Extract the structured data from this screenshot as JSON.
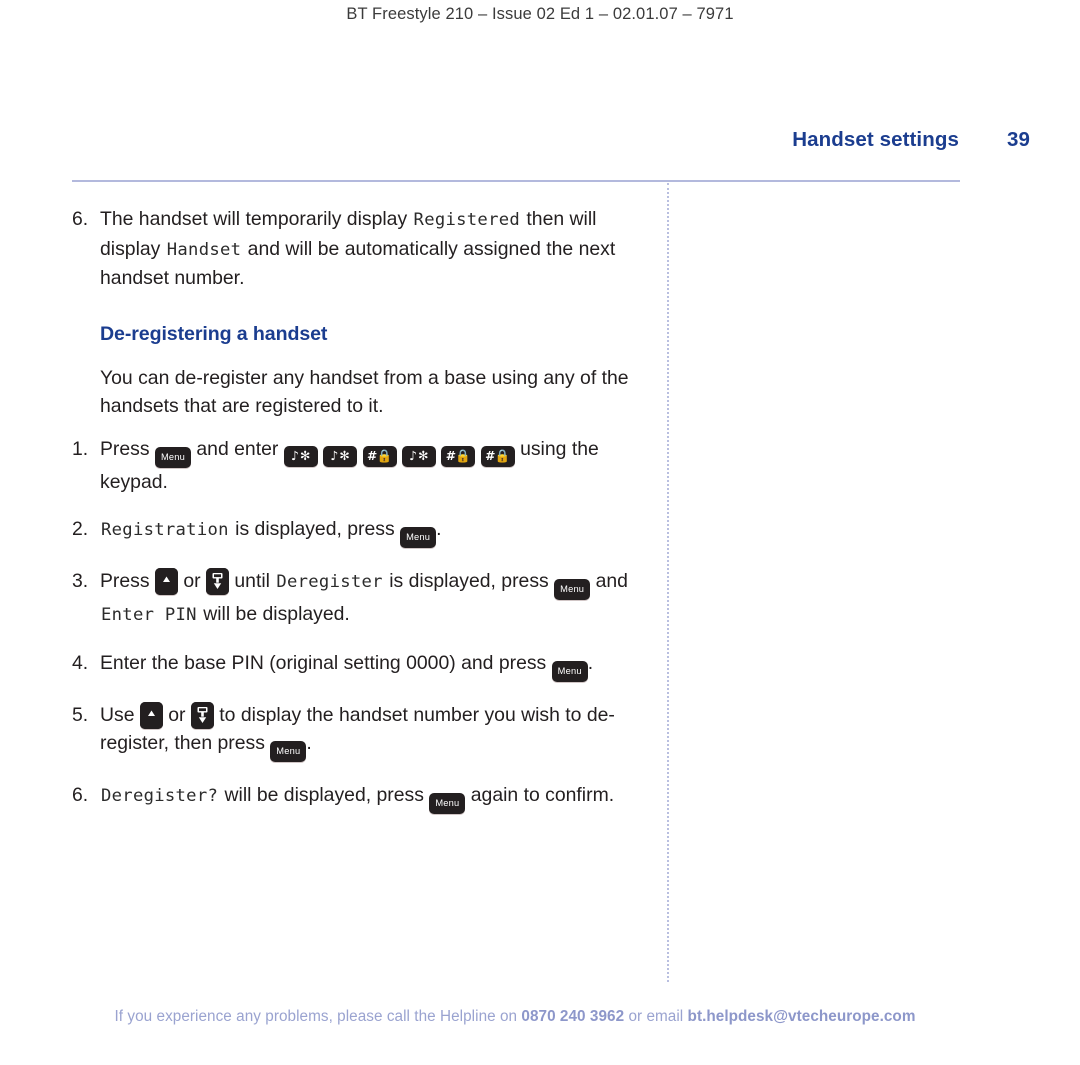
{
  "running_head": "BT Freestyle 210 – Issue 02 Ed 1 – 02.01.07 – 7971",
  "header": {
    "chapter_title": "Handset settings",
    "page_number": "39",
    "accent_color": "#1b3d8f"
  },
  "content": {
    "step6_top": {
      "number": "6.",
      "text_a": "The handset will temporarily display ",
      "lcd_a": "Registered",
      "text_b": " then will display ",
      "lcd_b": "Handset",
      "text_c": " and will be automatically assigned the next handset number."
    },
    "subheading": "De-registering a handset",
    "intro_paragraph": "You can de-register any handset from a base using any of the handsets that are registered to it.",
    "steps": [
      {
        "number": "1.",
        "text_a": "Press ",
        "key_menu": "Menu",
        "text_b": " and enter ",
        "keys": [
          "star",
          "star",
          "hash",
          "star",
          "hash",
          "hash"
        ],
        "text_c": " using the keypad."
      },
      {
        "number": "2.",
        "lcd_a": "Registration",
        "text_a": " is displayed, press ",
        "key_menu": "Menu",
        "text_b": "."
      },
      {
        "number": "3.",
        "text_a": "Press ",
        "key_up": "up",
        "text_b": " or ",
        "key_down": "down",
        "text_c": " until ",
        "lcd_a": "Deregister",
        "text_d": " is displayed, press ",
        "key_menu": "Menu",
        "text_e": " and ",
        "lcd_b": "Enter PIN",
        "text_f": " will be displayed."
      },
      {
        "number": "4.",
        "text_a": "Enter the base PIN (original setting 0000) and press ",
        "key_menu": "Menu",
        "text_b": "."
      },
      {
        "number": "5.",
        "text_a": "Use ",
        "key_up": "up",
        "text_b": " or ",
        "key_down": "down",
        "text_c": " to display the handset number you wish to de-register, then press ",
        "key_menu": "Menu",
        "text_d": "."
      },
      {
        "number": "6.",
        "lcd_a": "Deregister?",
        "text_a": " will be displayed, press ",
        "key_menu": "Menu",
        "text_b": " again to confirm."
      }
    ]
  },
  "footer": {
    "text_a": "If you experience any problems, please call the Helpline on ",
    "phone": "0870 240 3962",
    "text_b": " or email ",
    "email": "bt.helpdesk@vtecheurope.com",
    "color": "#9aa3d0"
  }
}
